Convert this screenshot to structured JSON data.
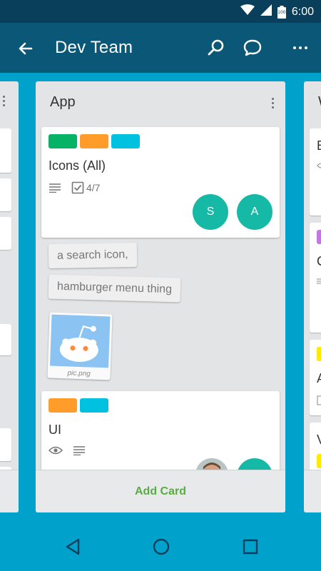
{
  "status_bar": {
    "time": "6:00",
    "battery_label": "100",
    "icons": [
      "wifi-icon",
      "signal-icon",
      "battery-icon"
    ]
  },
  "app_bar": {
    "title": "Dev Team",
    "icons": [
      "back-arrow-icon",
      "search-icon",
      "chat-icon",
      "overflow-menu-icon"
    ]
  },
  "left_list": {
    "card_count": 6
  },
  "main_list": {
    "title": "App",
    "cards": [
      {
        "labels": [
          "#06b265",
          "#ff9c2a",
          "#00c2e0"
        ],
        "title": "Icons (All)",
        "badges": {
          "description": true,
          "checklist": "4/7"
        },
        "members": [
          "S",
          "A"
        ]
      },
      {
        "labels": [
          "#ff9c2a",
          "#00c2e0"
        ],
        "title": "UI",
        "badges": {
          "watching": true,
          "description": true
        }
      }
    ],
    "dragged_chips": [
      "a search icon,",
      "hamburger menu thing"
    ],
    "attachment": {
      "filename": "pic.png"
    },
    "add_card_label": "Add Card"
  },
  "right_list": {
    "title_initial": "W",
    "visible_card_initials": [
      "B",
      "C",
      "A",
      "V"
    ],
    "label_colors": [
      "#c377e0",
      "#ffea00"
    ]
  },
  "nav_bar": {
    "icons": [
      "back-triangle-icon",
      "home-circle-icon",
      "recents-square-icon"
    ]
  },
  "colors": {
    "status_bar": "#0a3f5c",
    "app_bar": "#0b5777",
    "board": "#00a2cc",
    "list_bg": "#e2e4e6",
    "member": "#16b9a6",
    "add_card": "#5aac44"
  }
}
